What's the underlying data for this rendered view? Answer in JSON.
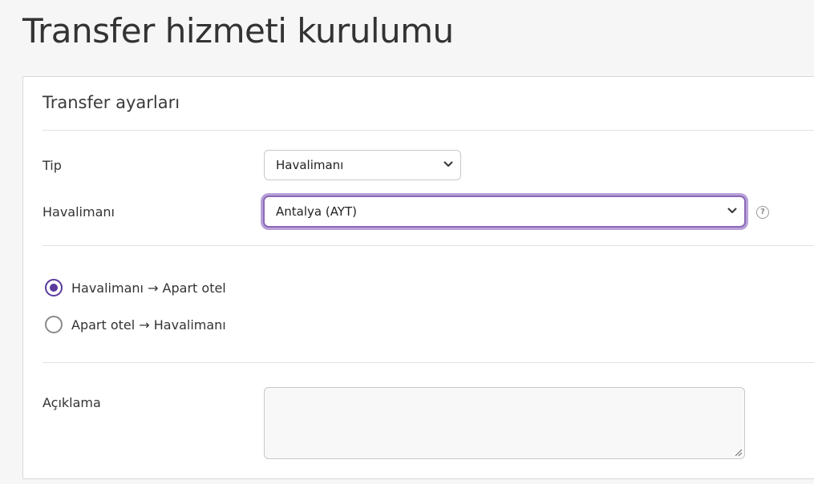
{
  "page": {
    "title": "Transfer hizmeti kurulumu"
  },
  "panel": {
    "heading": "Transfer ayarları"
  },
  "form": {
    "type": {
      "label": "Tip",
      "value": "Havalimanı",
      "icon": "chevron-down-icon"
    },
    "airport": {
      "label": "Havalimanı",
      "value": "Antalya (AYT)",
      "icon": "chevron-down-icon",
      "help_icon": "question-circle-icon",
      "help_glyph": "?"
    },
    "direction": {
      "options": [
        {
          "label": "Havalimanı → Apart otel",
          "checked": true
        },
        {
          "label": "Apart otel → Havalimanı",
          "checked": false
        }
      ]
    },
    "description": {
      "label": "Açıklama",
      "value": ""
    }
  },
  "colors": {
    "accent": "#5b3a9c",
    "focus_ring": "#8c69b8",
    "background": "#f6f6f6",
    "panel": "#ffffff"
  }
}
